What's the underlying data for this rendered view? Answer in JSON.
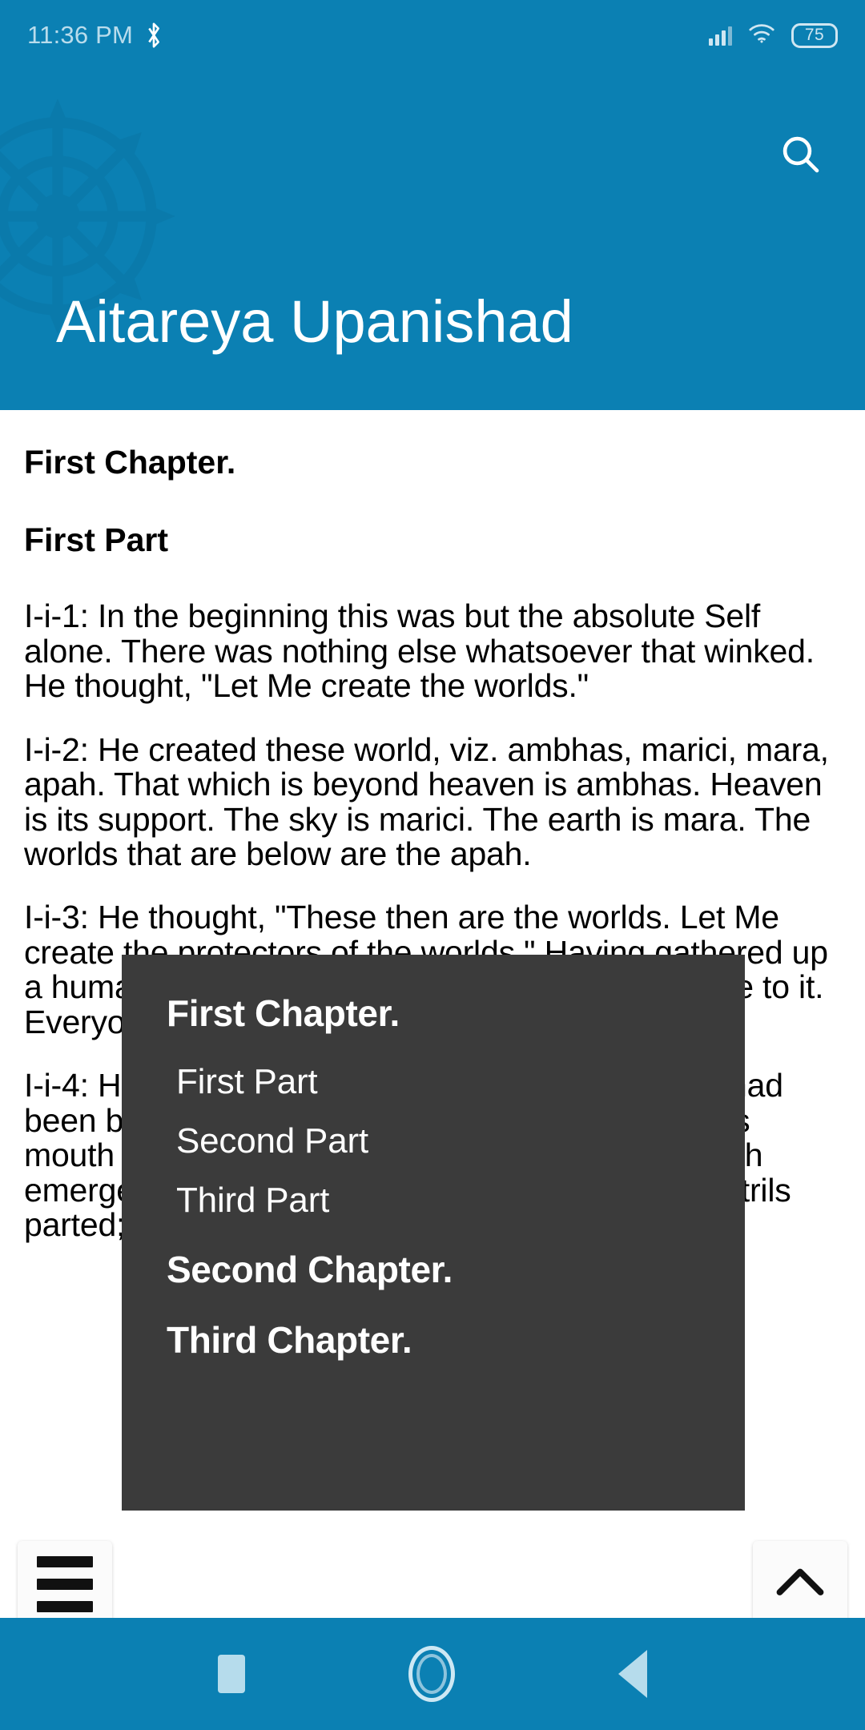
{
  "status_bar": {
    "time": "11:36 PM",
    "bluetooth_icon": "bluetooth-icon",
    "signal_icon": "cellular-signal-icon",
    "wifi_icon": "wifi-icon",
    "battery_level": "75"
  },
  "header": {
    "title": "Aitareya Upanishad",
    "search_icon": "search-icon",
    "watermark_icon": "dharma-wheel-icon",
    "background_color": "#0b80b3"
  },
  "content": {
    "chapter_heading": "First Chapter.",
    "part_heading": "First Part",
    "paragraphs": [
      "I-i-1: In the beginning this was but the absolute Self alone. There was nothing else whatsoever that winked. He thought, \"Let Me create the worlds.\"",
      "I-i-2: He created these world, viz. ambhas, marici, mara, apah. That which is beyond heaven is ambhas. Heaven is its support. The sky is marici. The earth is mara. The worlds that are below are the apah.",
      "I-i-3: He thought, \"These then are the worlds. Let Me create the protectors of the worlds.\" Having gathered up a human form from the water itself, He gave shape to it. Everyone that has a human form has to be to it.",
      "I-i-4: He brooded over him. Of him i.e. Virat, who had been brooded over (by that) was brooded over, his mouth parted, just as an egg does. From the mouth emerged speech; from speech came fire. The nostrils parted; from the nostrils"
    ]
  },
  "toc_menu": {
    "panel_color": "#3b3b3b",
    "items": [
      {
        "label": "First Chapter.",
        "type": "chapter"
      },
      {
        "label": "First Part",
        "type": "part"
      },
      {
        "label": "Second Part",
        "type": "part"
      },
      {
        "label": "Third Part",
        "type": "part"
      },
      {
        "label": "Second Chapter.",
        "type": "chapter"
      },
      {
        "label": "Third Chapter.",
        "type": "chapter"
      }
    ]
  },
  "floating_buttons": {
    "menu_icon": "hamburger-menu-icon",
    "scroll_top_icon": "chevron-up-icon"
  },
  "nav_bar": {
    "recents_icon": "recents-square-icon",
    "home_icon": "home-circle-icon",
    "back_icon": "back-triangle-icon",
    "background_color": "#0b80b3"
  }
}
